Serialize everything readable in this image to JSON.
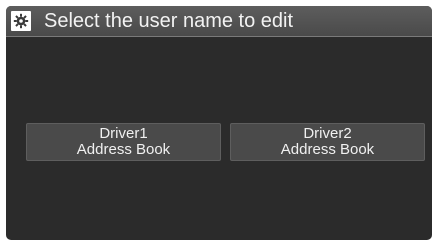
{
  "header": {
    "icon": "gear-icon",
    "title": "Select the user name to edit"
  },
  "options": [
    {
      "line1": "Driver1",
      "line2": "Address Book"
    },
    {
      "line1": "Driver2",
      "line2": "Address Book"
    }
  ],
  "colors": {
    "background": "#2b2b2b",
    "header": "#555555",
    "button": "#4a4a4a",
    "text": "#f0f0f0"
  }
}
